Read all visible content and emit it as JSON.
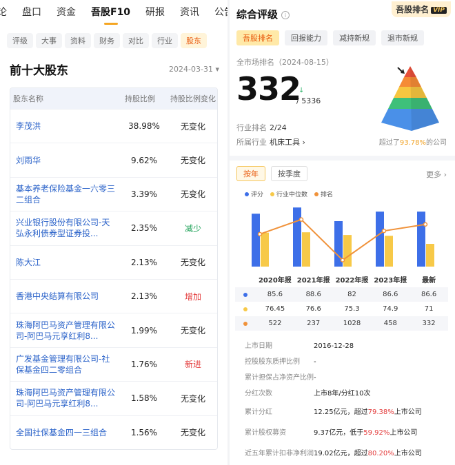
{
  "top_nav": [
    "论",
    "盘口",
    "资金",
    "吾股F10",
    "研报",
    "资讯",
    "公告"
  ],
  "sub_tabs": [
    "评级",
    "大事",
    "资料",
    "财务",
    "对比",
    "行业",
    "股东"
  ],
  "holders": {
    "title": "前十大股东",
    "date": "2024-03-31 ▾",
    "headers": [
      "股东名称",
      "持股比例",
      "持股比例变化"
    ],
    "rows": [
      {
        "name": "李茂洪",
        "pct": "38.98%",
        "change": "无变化",
        "type": "none"
      },
      {
        "name": "刘雨华",
        "pct": "9.62%",
        "change": "无变化",
        "type": "none"
      },
      {
        "name": "基本养老保险基金一六零三二组合",
        "pct": "3.39%",
        "change": "无变化",
        "type": "none"
      },
      {
        "name": "兴业银行股份有限公司-天弘永利债券型证券投...",
        "pct": "2.35%",
        "change": "减少",
        "type": "down"
      },
      {
        "name": "陈大江",
        "pct": "2.13%",
        "change": "无变化",
        "type": "none"
      },
      {
        "name": "香港中央结算有限公司",
        "pct": "2.13%",
        "change": "增加",
        "type": "up"
      },
      {
        "name": "珠海阿巴马资产管理有限公司-阿巴马元享红利8...",
        "pct": "1.99%",
        "change": "无变化",
        "type": "none"
      },
      {
        "name": "广发基金管理有限公司-社保基金四二零组合",
        "pct": "1.76%",
        "change": "新进",
        "type": "up"
      },
      {
        "name": "珠海阿巴马资产管理有限公司-阿巴马元享红利8...",
        "pct": "1.58%",
        "change": "无变化",
        "type": "none"
      },
      {
        "name": "全国社保基金四一三组合",
        "pct": "1.56%",
        "change": "无变化",
        "type": "none"
      }
    ]
  },
  "rating": {
    "title": "综合评级",
    "badge": "吾股排名",
    "vip": "VIP",
    "tabs": [
      "吾股排名",
      "回报能力",
      "减持新规",
      "退市新规"
    ],
    "rank_label": "全市场排名（2024-08-15）",
    "rank": "332",
    "rank_arrow": "↓",
    "rank_total": "/ 5336",
    "industry_rank_label": "行业排名",
    "industry_rank": "2/24",
    "industry_label": "所属行业",
    "industry": "机床工具 ›",
    "beat_prefix": "超过了",
    "beat_pct": "93.78%",
    "beat_suffix": "的公司"
  },
  "history": {
    "tabs": [
      "按年",
      "按季度"
    ],
    "more": "更多 ›",
    "legend": [
      "评分",
      "行业中位数",
      "排名"
    ],
    "colors": {
      "score": "#3d6fe8",
      "median": "#f7c948",
      "rank": "#f0923a"
    }
  },
  "chart_data": {
    "type": "bar",
    "categories": [
      "2020年报",
      "2021年报",
      "2022年报",
      "2023年报",
      "最新"
    ],
    "series": [
      {
        "name": "评分",
        "values": [
          85.6,
          88.6,
          82,
          86.6,
          86.6
        ]
      },
      {
        "name": "行业中位数",
        "values": [
          76.45,
          76.6,
          75.3,
          74.9,
          71
        ]
      },
      {
        "name": "排名",
        "values": [
          522,
          237,
          1028,
          458,
          332
        ],
        "type": "line"
      }
    ]
  },
  "table_values": {
    "score": [
      "85.6",
      "88.6",
      "82",
      "86.6",
      "86.6"
    ],
    "median": [
      "76.45",
      "76.6",
      "75.3",
      "74.9",
      "71"
    ],
    "rank": [
      "522",
      "237",
      "1028",
      "458",
      "332"
    ]
  },
  "key_info": [
    {
      "k": "上市日期",
      "v": "2016-12-28"
    },
    {
      "k": "控股股东质押比例",
      "v": "-"
    },
    {
      "k": "累计担保占净资产比例",
      "v": "-"
    },
    {
      "k": "分红次数",
      "v": "上市8年/分红10次"
    },
    {
      "k": "累计分红",
      "v1": "12.25亿元，超过",
      "hl": "79.38%",
      "v2": "上市公司"
    },
    {
      "k": "累计股权募资",
      "v1": "9.37亿元，低于",
      "hl": "59.92%",
      "v2": "上市公司"
    },
    {
      "k": "近五年累计扣非净利润",
      "v1": "19.02亿元，超过",
      "hl": "80.20%",
      "v2": "上市公司"
    }
  ]
}
